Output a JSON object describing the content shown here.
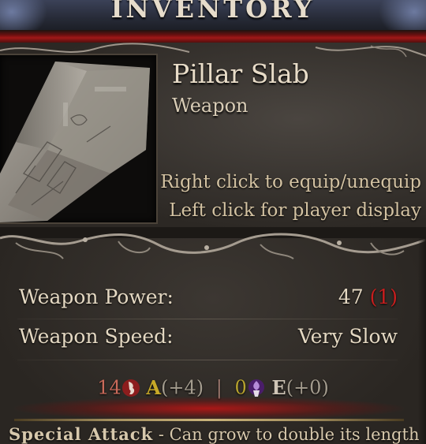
{
  "header": {
    "title": "INVENTORY"
  },
  "item": {
    "name": "Pillar Slab",
    "type": "Weapon",
    "hint_equip": "Right click to equip/unequip",
    "hint_display": "Left click for player display"
  },
  "stats": {
    "power_label": "Weapon Power:",
    "power_value": "47",
    "power_bonus": "(1)",
    "speed_label": "Weapon Speed:",
    "speed_value": "Very Slow"
  },
  "requirements": {
    "strength_value": "14",
    "strength_letter": "A",
    "strength_bonus": "(+4)",
    "separator": "|",
    "essence_value": "0",
    "essence_letter": "E",
    "essence_bonus": "(+0)"
  },
  "special_attack": {
    "label": "Special Attack",
    "description": " - Can grow to double its length"
  },
  "colors": {
    "bonus_red": "#c81e1e",
    "accent_gold": "#c8a928",
    "text_parchment": "#e4d8c2"
  },
  "icons": [
    "strength-icon",
    "essence-icon"
  ]
}
